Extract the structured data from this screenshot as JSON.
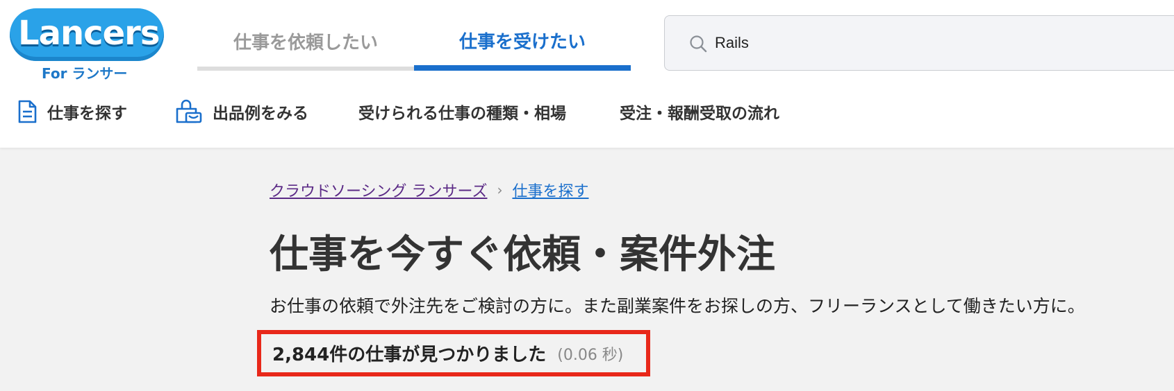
{
  "logo": {
    "text": "Lancers",
    "sub": "For ランサー"
  },
  "tabs": [
    {
      "label": "仕事を依頼したい",
      "active": false
    },
    {
      "label": "仕事を受けたい",
      "active": true
    }
  ],
  "search": {
    "value": "Rails"
  },
  "subnav": [
    {
      "label": "仕事を探す",
      "icon": "document-icon"
    },
    {
      "label": "出品例をみる",
      "icon": "shop-bag-icon"
    },
    {
      "label": "受けられる仕事の種類・相場"
    },
    {
      "label": "受注・報酬受取の流れ"
    }
  ],
  "breadcrumb": [
    {
      "label": "クラウドソーシング ランサーズ"
    },
    {
      "label": "仕事を探す"
    }
  ],
  "page": {
    "title": "仕事を今すぐ依頼・案件外注",
    "description": "お仕事の依頼で外注先をご検討の方に。また副業案件をお探しの方、フリーランスとして働きたい方に。"
  },
  "result": {
    "count_text": "2,844件の仕事が見つかりました",
    "time_text": "(0.06 秒)"
  },
  "colors": {
    "accent": "#1a6fcc",
    "highlight_box": "#e8281a",
    "visited_link": "#5b2a86"
  }
}
